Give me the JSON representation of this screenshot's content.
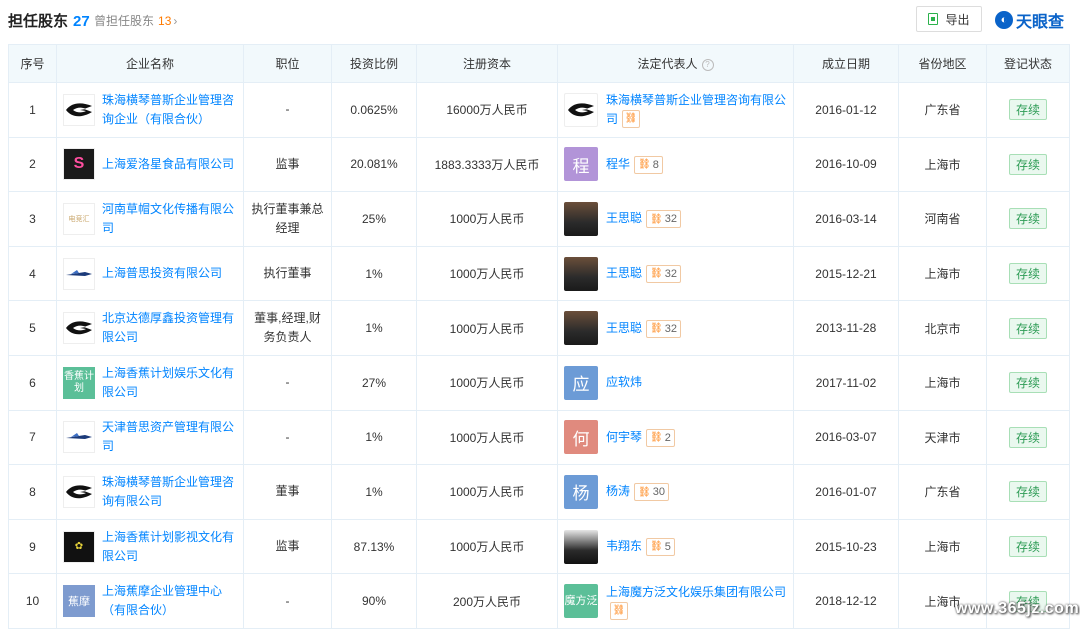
{
  "header": {
    "tab_main_label": "担任股东",
    "tab_main_count": "27",
    "tab_sub_label": "曾担任股东",
    "tab_sub_count": "13",
    "export_label": "导出",
    "brand_name": "天眼查"
  },
  "table": {
    "columns": [
      "序号",
      "企业名称",
      "职位",
      "投资比例",
      "注册资本",
      "法定代表人",
      "成立日期",
      "省份地区",
      "登记状态"
    ],
    "rows": [
      {
        "idx": "1",
        "company": "珠海横琴普斯企业管理咨询企业（有限合伙）",
        "logo": "bird-logo",
        "position": "-",
        "ratio": "0.0625%",
        "capital": "16000万人民币",
        "rep": "珠海横琴普斯企业管理咨询有限公司",
        "rep_avatar": "bird-logo",
        "rep_badge": "",
        "date": "2016-01-12",
        "region": "广东省",
        "status": "存续"
      },
      {
        "idx": "2",
        "company": "上海爱洛星食品有限公司",
        "logo": "S",
        "position": "监事",
        "ratio": "20.081%",
        "capital": "1883.3333万人民币",
        "rep": "程华",
        "rep_avatar": "程",
        "rep_badge": "8",
        "date": "2016-10-09",
        "region": "上海市",
        "status": "存续"
      },
      {
        "idx": "3",
        "company": "河南草帽文化传播有限公司",
        "logo": "电竞汇",
        "position": "执行董事兼总经理",
        "ratio": "25%",
        "capital": "1000万人民币",
        "rep": "王思聪",
        "rep_avatar": "photo",
        "rep_badge": "32",
        "date": "2016-03-14",
        "region": "河南省",
        "status": "存续"
      },
      {
        "idx": "4",
        "company": "上海普思投资有限公司",
        "logo": "plane-logo",
        "position": "执行董事",
        "ratio": "1%",
        "capital": "1000万人民币",
        "rep": "王思聪",
        "rep_avatar": "photo",
        "rep_badge": "32",
        "date": "2015-12-21",
        "region": "上海市",
        "status": "存续"
      },
      {
        "idx": "5",
        "company": "北京达德厚鑫投资管理有限公司",
        "logo": "bird-logo",
        "position": "董事,经理,财务负责人",
        "ratio": "1%",
        "capital": "1000万人民币",
        "rep": "王思聪",
        "rep_avatar": "photo",
        "rep_badge": "32",
        "date": "2013-11-28",
        "region": "北京市",
        "status": "存续"
      },
      {
        "idx": "6",
        "company": "上海香蕉计划娱乐文化有限公司",
        "logo": "香蕉计划",
        "position": "-",
        "ratio": "27%",
        "capital": "1000万人民币",
        "rep": "应软炜",
        "rep_avatar": "应",
        "rep_badge": "",
        "date": "2017-11-02",
        "region": "上海市",
        "status": "存续"
      },
      {
        "idx": "7",
        "company": "天津普思资产管理有限公司",
        "logo": "plane-logo",
        "position": "-",
        "ratio": "1%",
        "capital": "1000万人民币",
        "rep": "何宇琴",
        "rep_avatar": "何",
        "rep_badge": "2",
        "date": "2016-03-07",
        "region": "天津市",
        "status": "存续"
      },
      {
        "idx": "8",
        "company": "珠海横琴普斯企业管理咨询有限公司",
        "logo": "bird-logo",
        "position": "董事",
        "ratio": "1%",
        "capital": "1000万人民币",
        "rep": "杨涛",
        "rep_avatar": "杨",
        "rep_badge": "30",
        "date": "2016-01-07",
        "region": "广东省",
        "status": "存续"
      },
      {
        "idx": "9",
        "company": "上海香蕉计划影视文化有限公司",
        "logo": "banana-logo",
        "position": "监事",
        "ratio": "87.13%",
        "capital": "1000万人民币",
        "rep": "韦翔东",
        "rep_avatar": "photo2",
        "rep_badge": "5",
        "date": "2015-10-23",
        "region": "上海市",
        "status": "存续"
      },
      {
        "idx": "10",
        "company": "上海蕉摩企业管理中心（有限合伙）",
        "logo": "蕉摩",
        "position": "-",
        "ratio": "90%",
        "capital": "200万人民币",
        "rep": "上海魔方泛文化娱乐集团有限公司",
        "rep_avatar": "魔方泛",
        "rep_badge": "",
        "date": "2018-12-12",
        "region": "上海市",
        "status": "存续"
      }
    ]
  },
  "watermark": "www.365jz.com",
  "colors": {
    "link": "#0084ff",
    "accent_orange": "#ff7a00",
    "status_green": "#2e9c56",
    "header_bg": "#f2f9fc"
  }
}
